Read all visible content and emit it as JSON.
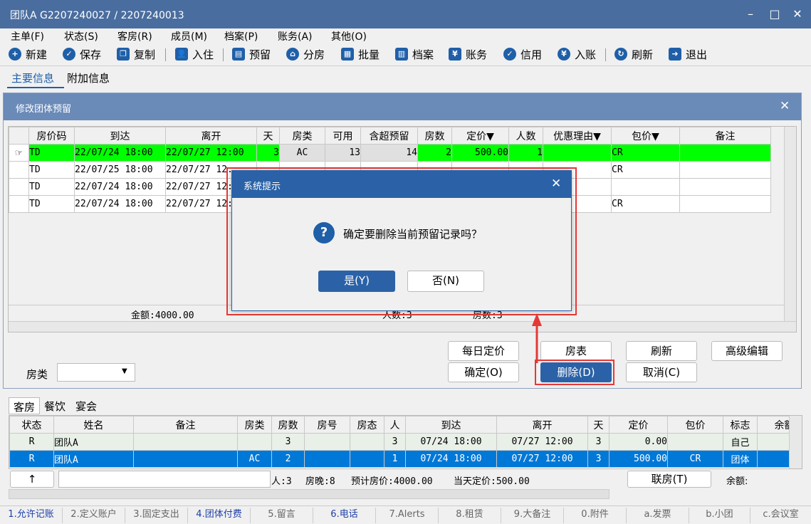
{
  "window": {
    "title": "团队A  G2207240027  /  2207240013"
  },
  "menu": [
    "主单(F)",
    "状态(S)",
    "客房(R)",
    "成员(M)",
    "档案(P)",
    "账务(A)",
    "其他(O)"
  ],
  "toolbar": {
    "new": "新建",
    "save": "保存",
    "copy": "复制",
    "checkin": "入住",
    "reserve": "预留",
    "assign": "分房",
    "batch": "批量",
    "archive": "档案",
    "account": "账务",
    "credit": "信用",
    "post": "入账",
    "refresh": "刷新",
    "exit": "退出"
  },
  "tabs": {
    "main": "主要信息",
    "extra": "附加信息"
  },
  "panel": {
    "title": "修改团体预留"
  },
  "res_grid": {
    "headers": [
      "房价码",
      "到达",
      "离开",
      "天",
      "房类",
      "可用",
      "含超预留",
      "房数",
      "定价▼",
      "人数",
      "优惠理由▼",
      "包价▼",
      "备注"
    ],
    "rows": [
      [
        "TD",
        "22/07/24 18:00",
        "22/07/27 12:00",
        "3",
        "AC",
        "13",
        "14",
        "2",
        "500.00",
        "1",
        "",
        "CR",
        ""
      ],
      [
        "TD",
        "22/07/25 18:00",
        "22/07/27 12:",
        "",
        "",
        "",
        "",
        "",
        "",
        "",
        "",
        "CR",
        ""
      ],
      [
        "TD",
        "22/07/24 18:00",
        "22/07/27 12:",
        "",
        "",
        "",
        "",
        "",
        "",
        "",
        "",
        "",
        ""
      ],
      [
        "TD",
        "22/07/24 18:00",
        "22/07/27 12:",
        "",
        "",
        "",
        "",
        "",
        "",
        "",
        "",
        "CR",
        ""
      ]
    ],
    "footer_amount": "金额:4000.00",
    "footer_persons": "人数:3",
    "footer_rooms": "房数:3"
  },
  "panel_buttons": {
    "daily_rate": "每日定价",
    "room_chart": "房表",
    "refresh": "刷新",
    "adv_edit": "高级编辑",
    "ok": "确定(O)",
    "delete": "删除(D)",
    "cancel": "取消(C)"
  },
  "roomtype_label": "房类",
  "dialog": {
    "title": "系统提示",
    "message": "确定要删除当前预留记录吗？",
    "yes": "是(Y)",
    "no": "否(N)"
  },
  "bottom_tabs": [
    "客房",
    "餐饮",
    "宴会"
  ],
  "member_grid": {
    "headers": [
      "状态",
      "姓名",
      "备注",
      "房类",
      "房数",
      "房号",
      "房态",
      "人",
      "到达",
      "离开",
      "天",
      "定价",
      "包价",
      "标志",
      "余额"
    ],
    "rows": [
      [
        "R",
        "团队A",
        "",
        "",
        "3",
        "",
        "",
        "3",
        "07/24 18:00",
        "07/27 12:00",
        "3",
        "0.00",
        "",
        "自己",
        ""
      ],
      [
        "R",
        "团队A",
        "",
        "AC",
        "2",
        "",
        "",
        "1",
        "07/24 18:00",
        "07/27 12:00",
        "3",
        "500.00",
        "CR",
        "团体",
        ""
      ]
    ]
  },
  "summary": {
    "up_arrow": "↑",
    "persons": "人:3",
    "nights": "房晚:8",
    "est": "预计房价:4000.00",
    "today": "当天定价:500.00",
    "link_room": "联房(T)",
    "balance": "余额:"
  },
  "statusbar": [
    "1.允许记账",
    "2.定义账户",
    "3.固定支出",
    "4.团体付费",
    "5.留言",
    "6.电话",
    "7.Alerts",
    "8.租赁",
    "9.大备注",
    "0.附件",
    "a.发票",
    "b.小团",
    "c.会议室"
  ],
  "colors": {
    "title_bg": "#4a6d9f",
    "green_row": "#00ff00",
    "select_blue": "#0078d7",
    "dialog_title": "#2b62a7",
    "highlight": "#e53935"
  }
}
